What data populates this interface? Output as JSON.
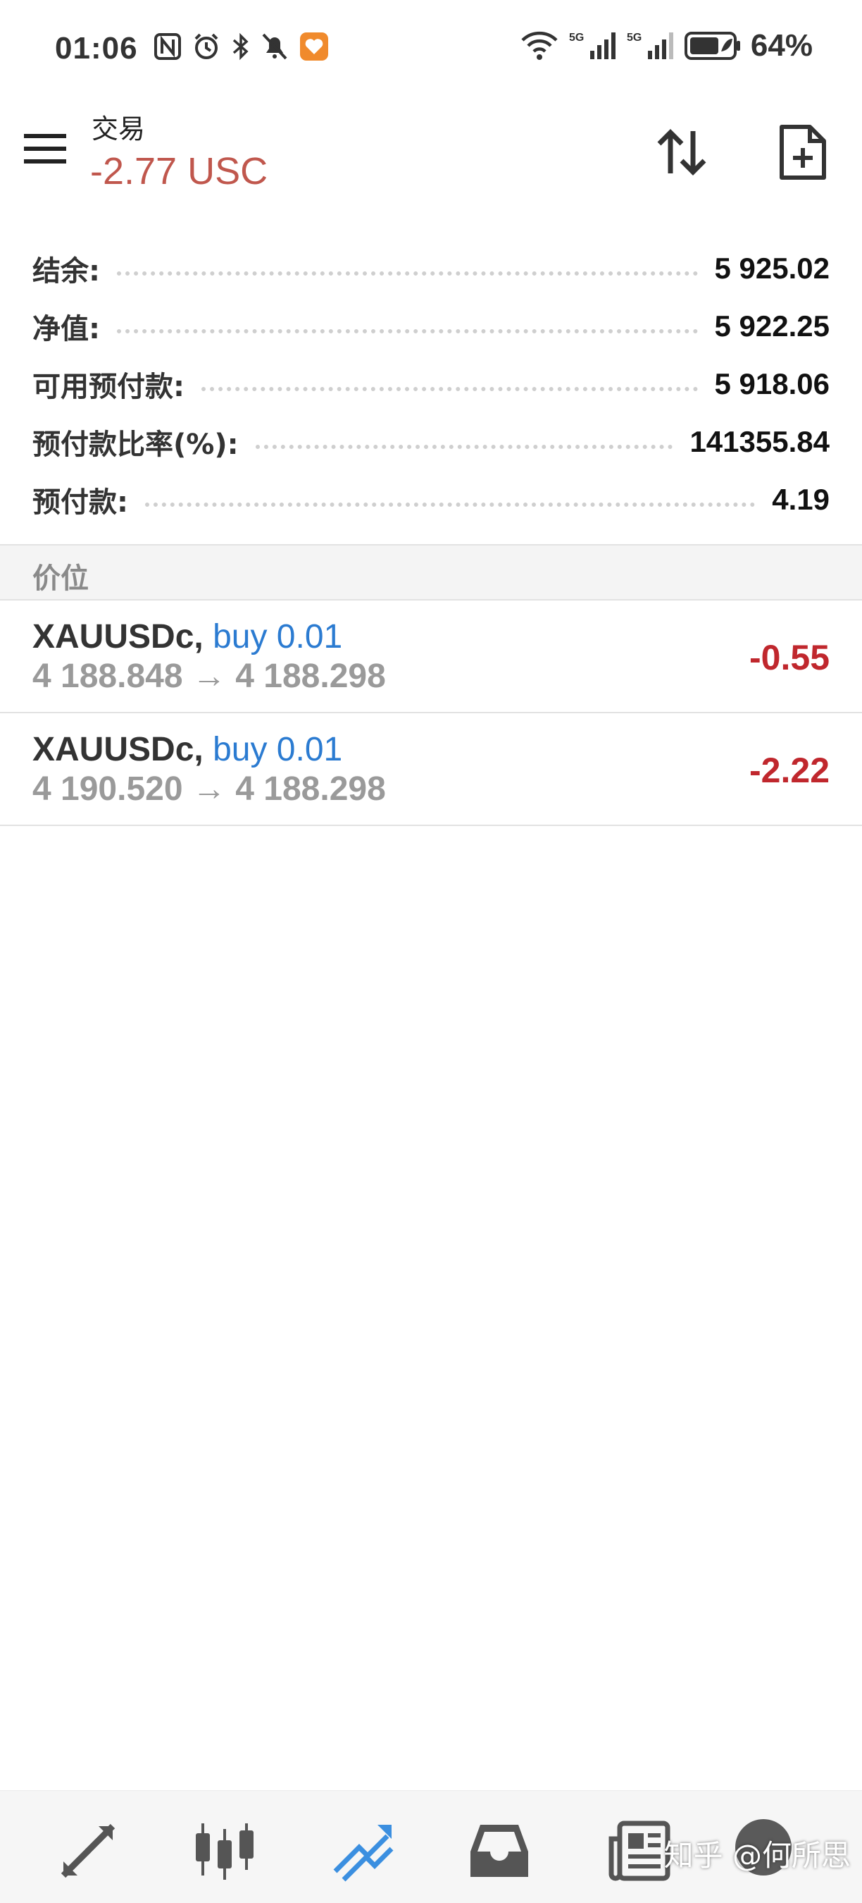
{
  "status_bar": {
    "time": "01:06",
    "battery_percent": "64%",
    "network_1": "5G",
    "network_2": "5G"
  },
  "header": {
    "title": "交易",
    "balance": "-2.77 USC"
  },
  "summary": [
    {
      "label": "结余:",
      "value": "5 925.02"
    },
    {
      "label": "净值:",
      "value": "5 922.25"
    },
    {
      "label": "可用预付款:",
      "value": "5 918.06"
    },
    {
      "label": "预付款比率(%):",
      "value": "141355.84"
    },
    {
      "label": "预付款:",
      "value": "4.19"
    }
  ],
  "positions_section": {
    "title": "价位"
  },
  "positions": [
    {
      "symbol": "XAUUSDc,",
      "side": "buy 0.01",
      "open_price": "4 188.848",
      "arrow": "→",
      "current_price": "4 188.298",
      "profit": "-0.55"
    },
    {
      "symbol": "XAUUSDc,",
      "side": "buy 0.01",
      "open_price": "4 190.520",
      "arrow": "→",
      "current_price": "4 188.298",
      "profit": "-2.22"
    }
  ],
  "watermark": "知乎 @何所思",
  "colors": {
    "balance_negative": "#c0574d",
    "profit_negative": "#c0272d",
    "side_buy": "#2b7bd1",
    "nav_active": "#3b8fe0"
  },
  "bottom_nav": {
    "items": [
      "quotes-icon",
      "chart-icon",
      "trade-icon",
      "history-icon",
      "news-icon"
    ],
    "active": "trade-icon"
  }
}
